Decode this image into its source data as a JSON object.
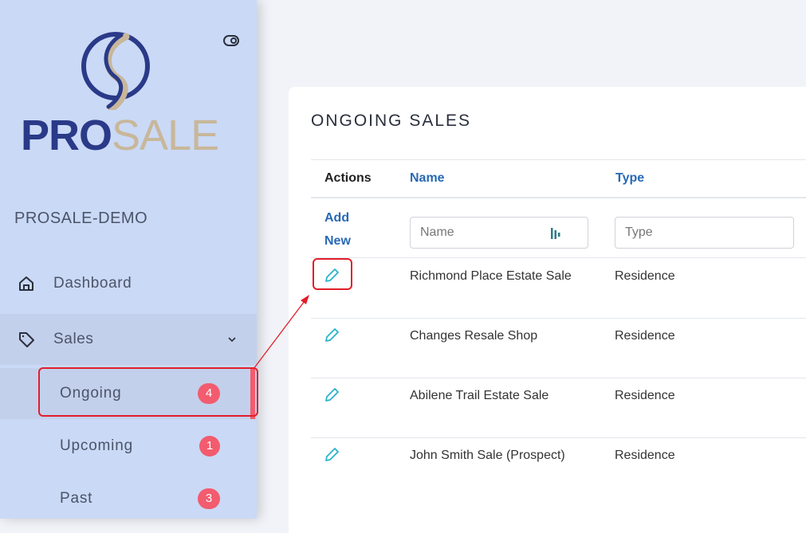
{
  "sidebar": {
    "logo": {
      "text_pro": "PRO",
      "text_sale": "SALE",
      "name": "prosale-logo"
    },
    "tenant": "PROSALE-DEMO",
    "nav": {
      "dashboard": "Dashboard",
      "sales": "Sales"
    },
    "sales_sub": [
      {
        "label": "Ongoing",
        "count": "4"
      },
      {
        "label": "Upcoming",
        "count": "1"
      },
      {
        "label": "Past",
        "count": "3"
      }
    ],
    "colors": {
      "accent": "#f25c6e",
      "bg": "#cad9f6"
    }
  },
  "main": {
    "title": "ONGOING SALES",
    "columns": {
      "actions": "Actions",
      "name": "Name",
      "type": "Type"
    },
    "add_new": "Add New",
    "filters": {
      "name_placeholder": "Name",
      "type_placeholder": "Type"
    },
    "rows": [
      {
        "name": "Richmond Place Estate Sale",
        "type": "Residence"
      },
      {
        "name": "Changes Resale Shop",
        "type": "Residence"
      },
      {
        "name": "Abilene Trail Estate Sale",
        "type": "Residence"
      },
      {
        "name": "John Smith Sale (Prospect)",
        "type": "Residence"
      }
    ]
  }
}
